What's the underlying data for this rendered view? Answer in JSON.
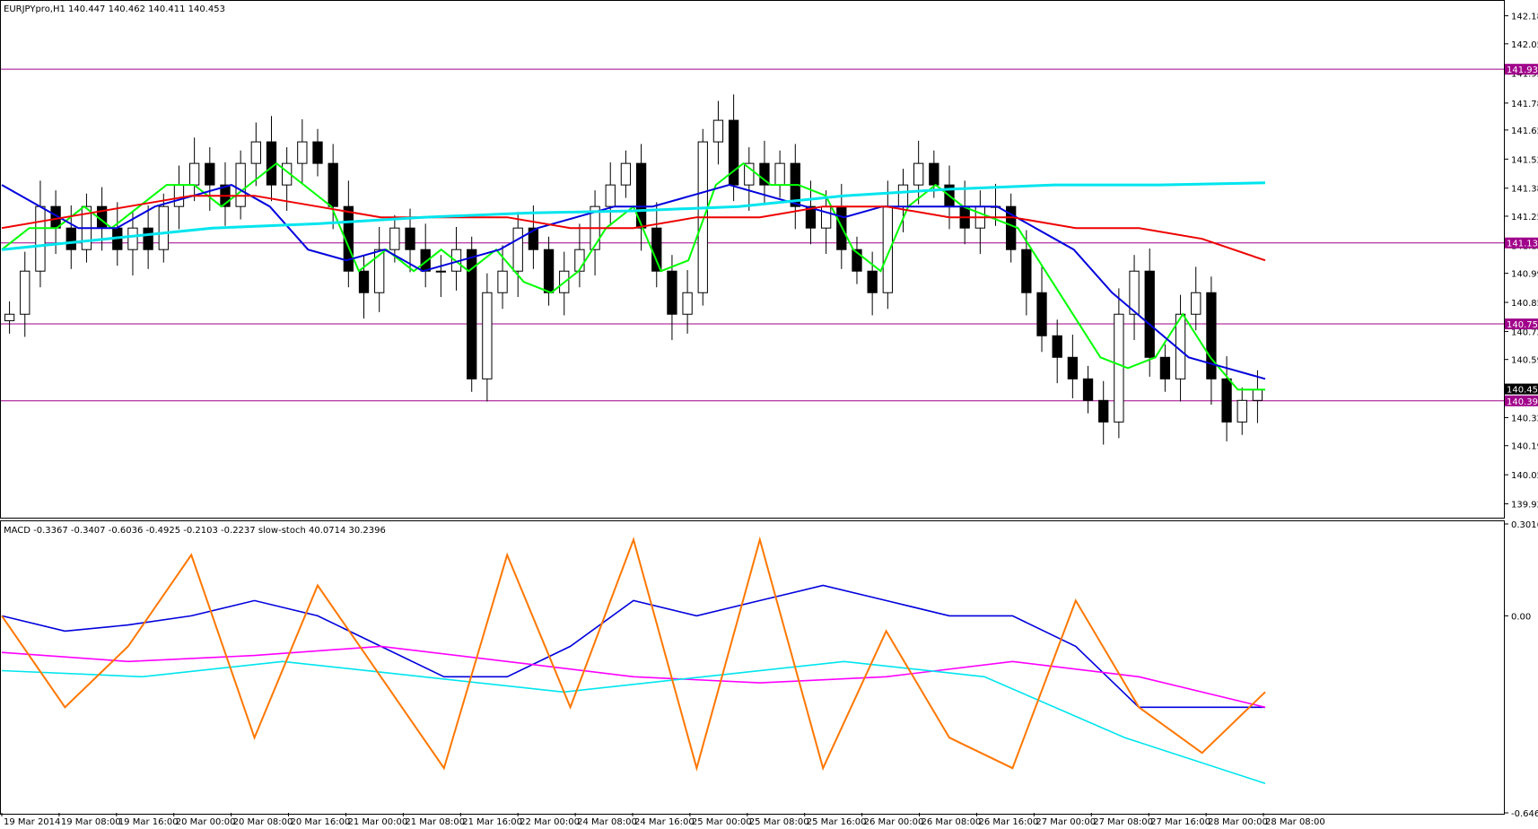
{
  "chart_data": [
    {
      "type": "line",
      "title": "EURJPYpro,H1  140.447 140.462 140.411 140.453",
      "symbol": "EURJPYpro,H1",
      "ohlc_header": {
        "open": 140.447,
        "high": 140.462,
        "low": 140.411,
        "close": 140.453
      },
      "ylim": [
        139.86,
        142.25
      ],
      "y_ticks": [
        "142.185",
        "142.055",
        "141.920",
        "141.780",
        "141.655",
        "141.520",
        "141.385",
        "141.255",
        "141.120",
        "140.990",
        "140.855",
        "140.720",
        "140.590",
        "140.455",
        "140.320",
        "140.190",
        "140.055",
        "139.920"
      ],
      "price_tags": [
        {
          "value": 141.937,
          "label": "141.937",
          "bg": "#a0008a"
        },
        {
          "value": 141.131,
          "label": "141.131",
          "bg": "#a0008a"
        },
        {
          "value": 140.755,
          "label": "140.755",
          "bg": "#a0008a"
        },
        {
          "value": 140.453,
          "label": "140.453",
          "bg": "#000000"
        },
        {
          "value": 140.398,
          "label": "140.398",
          "bg": "#a0008a"
        }
      ],
      "horizontal_levels": [
        141.937,
        141.131,
        140.755,
        140.398
      ],
      "x_labels": [
        "19 Mar 2014",
        "19 Mar 08:00",
        "19 Mar 16:00",
        "20 Mar 00:00",
        "20 Mar 08:00",
        "20 Mar 16:00",
        "21 Mar 00:00",
        "21 Mar 08:00",
        "21 Mar 16:00",
        "22 Mar 00:00",
        "24 Mar 08:00",
        "24 Mar 16:00",
        "25 Mar 00:00",
        "25 Mar 08:00",
        "25 Mar 16:00",
        "26 Mar 00:00",
        "26 Mar 08:00",
        "26 Mar 16:00",
        "27 Mar 00:00",
        "27 Mar 08:00",
        "27 Mar 16:00",
        "28 Mar 00:00",
        "28 Mar 08:00"
      ],
      "close_series": [
        140.8,
        141.0,
        141.3,
        141.2,
        141.1,
        141.3,
        141.2,
        141.1,
        141.2,
        141.1,
        141.3,
        141.4,
        141.5,
        141.4,
        141.3,
        141.5,
        141.6,
        141.4,
        141.5,
        141.6,
        141.5,
        141.3,
        141.0,
        140.9,
        141.1,
        141.2,
        141.1,
        141.0,
        141.0,
        141.1,
        140.5,
        140.9,
        141.0,
        141.2,
        141.1,
        140.9,
        141.0,
        141.1,
        141.3,
        141.4,
        141.5,
        141.2,
        141.0,
        140.8,
        140.9,
        141.6,
        141.7,
        141.4,
        141.5,
        141.4,
        141.5,
        141.3,
        141.2,
        141.3,
        141.1,
        141.0,
        140.9,
        141.3,
        141.4,
        141.5,
        141.4,
        141.3,
        141.2,
        141.3,
        141.3,
        141.1,
        140.9,
        140.7,
        140.6,
        140.5,
        140.4,
        140.3,
        140.8,
        141.0,
        140.6,
        140.5,
        140.8,
        140.9,
        140.5,
        140.3,
        140.4,
        140.45
      ],
      "series": [
        {
          "name": "",
          "color": "#00ff00",
          "values": [
            141.1,
            141.2,
            141.2,
            141.3,
            141.2,
            141.3,
            141.4,
            141.4,
            141.3,
            141.4,
            141.5,
            141.4,
            141.3,
            141.0,
            141.1,
            141.0,
            141.1,
            141.0,
            141.1,
            140.95,
            140.9,
            141.0,
            141.2,
            141.3,
            141.0,
            141.05,
            141.4,
            141.5,
            141.4,
            141.4,
            141.35,
            141.1,
            141.0,
            141.3,
            141.4,
            141.3,
            141.25,
            141.2,
            141.0,
            140.8,
            140.6,
            140.55,
            140.6,
            140.8,
            140.6,
            140.45,
            140.45
          ]
        },
        {
          "name": "",
          "color": "#0000dd",
          "values": [
            141.4,
            141.3,
            141.2,
            141.2,
            141.3,
            141.35,
            141.4,
            141.3,
            141.1,
            141.05,
            141.1,
            141.0,
            141.05,
            141.1,
            141.2,
            141.25,
            141.3,
            141.3,
            141.35,
            141.4,
            141.35,
            141.3,
            141.25,
            141.3,
            141.3,
            141.3,
            141.3,
            141.2,
            141.1,
            140.9,
            140.75,
            140.6,
            140.55,
            140.5
          ]
        },
        {
          "name": "",
          "color": "#ee0000",
          "values": [
            141.2,
            141.25,
            141.3,
            141.35,
            141.35,
            141.3,
            141.25,
            141.25,
            141.25,
            141.2,
            141.2,
            141.25,
            141.25,
            141.3,
            141.3,
            141.25,
            141.25,
            141.2,
            141.2,
            141.15,
            141.05
          ]
        },
        {
          "name": "",
          "color": "#00e5ee",
          "values": [
            141.1,
            141.15,
            141.2,
            141.22,
            141.25,
            141.27,
            141.28,
            141.3,
            141.35,
            141.38,
            141.4,
            141.4,
            141.41
          ]
        }
      ]
    },
    {
      "type": "line",
      "title": "MACD -0.3367 -0.3407 -0.6036 -0.4925 -0.2103 -0.2237  slow-stoch 40.0714 30.2396",
      "ylim": [
        -0.6467,
        0.3016
      ],
      "y_ticks": [
        "0.3016",
        "0.00",
        "-0.6467"
      ],
      "series": [
        {
          "name": "",
          "color": "#0000dd",
          "values": [
            0.0,
            -0.05,
            -0.03,
            0.0,
            0.05,
            0.0,
            -0.1,
            -0.2,
            -0.2,
            -0.1,
            0.05,
            0.0,
            0.05,
            0.1,
            0.05,
            0.0,
            0.0,
            -0.1,
            -0.3,
            -0.3,
            -0.3
          ]
        },
        {
          "name": "",
          "color": "#ff00ff",
          "values": [
            -0.12,
            -0.15,
            -0.13,
            -0.1,
            -0.15,
            -0.2,
            -0.22,
            -0.2,
            -0.15,
            -0.2,
            -0.3
          ]
        },
        {
          "name": "",
          "color": "#00e5ee",
          "values": [
            -0.18,
            -0.2,
            -0.15,
            -0.2,
            -0.25,
            -0.2,
            -0.15,
            -0.2,
            -0.4,
            -0.55
          ]
        },
        {
          "name": "",
          "color": "#ff7700",
          "values": [
            0.0,
            -0.3,
            -0.1,
            0.2,
            -0.4,
            0.1,
            -0.2,
            -0.5,
            0.2,
            -0.3,
            0.25,
            -0.5,
            0.25,
            -0.5,
            -0.05,
            -0.4,
            -0.5,
            0.05,
            -0.3,
            -0.45,
            -0.25
          ]
        }
      ]
    }
  ]
}
